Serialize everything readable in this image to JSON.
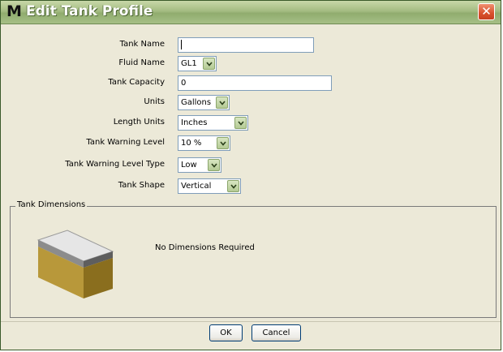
{
  "window": {
    "logo": "M",
    "title": "Edit Tank Profile",
    "close_label": "✕"
  },
  "form": {
    "tank_name": {
      "label": "Tank Name",
      "value": ""
    },
    "fluid_name": {
      "label": "Fluid Name",
      "value": "GL1"
    },
    "tank_capacity": {
      "label": "Tank Capacity",
      "value": "0"
    },
    "units": {
      "label": "Units",
      "value": "Gallons"
    },
    "length_units": {
      "label": "Length Units",
      "value": "Inches"
    },
    "tank_warning_level": {
      "label": "Tank Warning Level",
      "value": "10 %"
    },
    "tank_warning_level_type": {
      "label": "Tank Warning Level Type",
      "value": "Low"
    },
    "tank_shape": {
      "label": "Tank Shape",
      "value": "Vertical"
    }
  },
  "dimensions": {
    "title": "Tank Dimensions",
    "message": "No Dimensions Required"
  },
  "buttons": {
    "ok": "OK",
    "cancel": "Cancel"
  },
  "colors": {
    "titlebar": "#a4bc82",
    "close": "#d8502c",
    "tank_top": "#e6e6e6",
    "tank_front": "#b8983a",
    "tank_side": "#8a6e1e"
  }
}
